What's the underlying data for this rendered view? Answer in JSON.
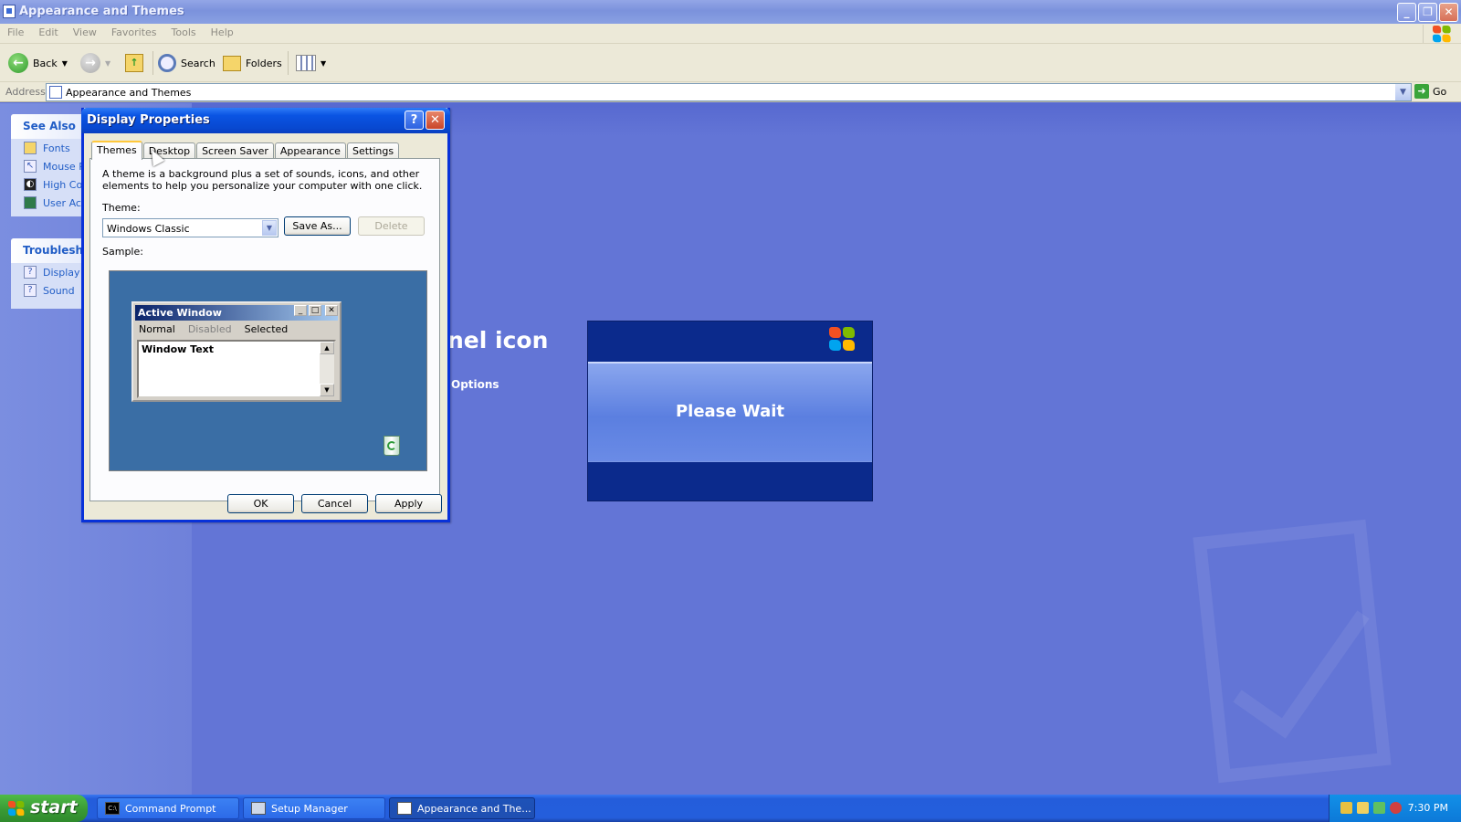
{
  "window": {
    "title": "Appearance and Themes",
    "controls": [
      "_",
      "❐",
      "✕"
    ]
  },
  "menu": [
    "File",
    "Edit",
    "View",
    "Favorites",
    "Tools",
    "Help"
  ],
  "toolbar": {
    "back_label": "Back",
    "search_label": "Search",
    "folders_label": "Folders"
  },
  "address": {
    "label": "Address",
    "value": "Appearance and Themes",
    "go_label": "Go"
  },
  "sidebar": {
    "see_also": {
      "title": "See Also",
      "items": [
        {
          "label": "Fonts",
          "icon": "folder-icon"
        },
        {
          "label": "Mouse P",
          "icon": "mouse-icon"
        },
        {
          "label": "High Co",
          "icon": "contrast-icon"
        },
        {
          "label": "User Ac",
          "icon": "users-icon"
        }
      ]
    },
    "troubleshooters": {
      "title": "Troublesho",
      "items": [
        {
          "label": "Display",
          "icon": "help-icon"
        },
        {
          "label": "Sound",
          "icon": "help-icon"
        }
      ]
    }
  },
  "background": {
    "heading_fragment": "nel icon",
    "link_fragment": "Options"
  },
  "please_wait": {
    "message": "Please Wait"
  },
  "dialog": {
    "title": "Display Properties",
    "help_glyph": "?",
    "close_glyph": "✕",
    "tabs": [
      "Themes",
      "Desktop",
      "Screen Saver",
      "Appearance",
      "Settings"
    ],
    "active_tab": "Themes",
    "description": "A theme is a background plus a set of sounds, icons, and other elements to help you personalize your computer with one click.",
    "theme_label": "Theme:",
    "theme_value": "Windows Classic",
    "save_as_label": "Save As...",
    "delete_label": "Delete",
    "sample_label": "Sample:",
    "sample": {
      "window_title": "Active Window",
      "menu_normal": "Normal",
      "menu_disabled": "Disabled",
      "menu_selected": "Selected",
      "window_text": "Window Text"
    },
    "ok_label": "OK",
    "cancel_label": "Cancel",
    "apply_label": "Apply"
  },
  "taskbar": {
    "start_label": "start",
    "tasks": [
      {
        "label": "Command Prompt",
        "icon": "cmd-icon"
      },
      {
        "label": "Setup Manager",
        "icon": "setup-manager-icon"
      },
      {
        "label": "Appearance and The...",
        "icon": "explorer-icon",
        "active": true
      }
    ],
    "clock": "7:30 PM"
  },
  "colors": {
    "desktop_bg": "#6375d6",
    "xp_blue_title": "#0a54e3",
    "start_green": "#3a9a35",
    "sample_desktop": "#3a6ea5"
  }
}
